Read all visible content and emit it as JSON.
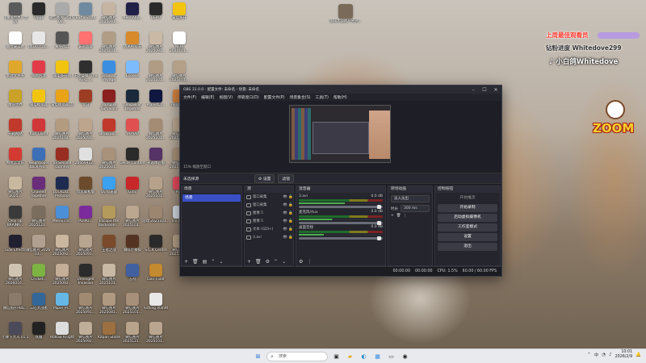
{
  "desktop": {
    "icons": [
      {
        "label": "《魔兽世界》大战",
        "color": "#5b5b5b"
      },
      {
        "label": "雅金豪工站",
        "color": "#ffffff"
      },
      {
        "label": "新建文件夹",
        "color": "#e0a82b"
      },
      {
        "label": "魔兽世界",
        "color": "#c9a227"
      },
      {
        "label": "开箱网站",
        "color": "#c0392b"
      },
      {
        "label": "网易云音乐",
        "color": "#d33a31"
      },
      {
        "label": "微信图片 2025...",
        "color": "#c9b8a0"
      },
      {
        "label": "Only Up BRAINR...",
        "color": "#3a3a3a"
      },
      {
        "label": "Side Effects",
        "color": "#202030"
      },
      {
        "label": "微信图片 2026010...",
        "color": "#cfc4b2"
      },
      {
        "label": "微信图片PBG...",
        "color": "#8b7b6a"
      },
      {
        "label": "小萝卜大人 v1.1",
        "color": "#4a4a5a"
      },
      {
        "label": "Oops",
        "color": "#2a2a2a"
      },
      {
        "label": "b6Dd1f1b...",
        "color": "#e7e7e7"
      },
      {
        "label": "网易回放",
        "color": "#e23b48"
      },
      {
        "label": "雷电模拟器",
        "color": "#f2c40f"
      },
      {
        "label": "Riot Client",
        "color": "#d13639"
      },
      {
        "label": "Neighbours back Fro...",
        "color": "#3d6fb6"
      },
      {
        "label": "Chained Together",
        "color": "#6a2d7a"
      },
      {
        "label": "微信图片 2025123...",
        "color": "#7a6d5d"
      },
      {
        "label": "微信图片 2026-01...",
        "color": "#b0a090"
      },
      {
        "label": "Cricket...",
        "color": "#7cb342"
      },
      {
        "label": "三吃大战者",
        "color": "#336699"
      },
      {
        "label": "铁狼",
        "color": "#222222"
      },
      {
        "label": "微信图片 2025-08...",
        "color": "#aaaaaa"
      },
      {
        "label": "撒豆战兵",
        "color": "#555555"
      },
      {
        "label": "雷电多开器",
        "color": "#f2c40f"
      },
      {
        "label": "雷电模拟器10",
        "color": "#e8a316"
      },
      {
        "label": "微信图片 2025102...",
        "color": "#b39b80"
      },
      {
        "label": "6x Second Dummy",
        "color": "#992d22"
      },
      {
        "label": "LOCKDO... Protocol",
        "color": "#1d2b50"
      },
      {
        "label": "MemoTra...",
        "color": "#4b8fd6"
      },
      {
        "label": "微信图片 2025092...",
        "color": "#cbb7a0"
      },
      {
        "label": "微信图片 2025092...",
        "color": "#c4ae98"
      },
      {
        "label": "Paper Pl...",
        "color": "#65b8e6"
      },
      {
        "label": "Hollow Knight",
        "color": "#dddddd"
      },
      {
        "label": "BattleState",
        "color": "#6f8aa0"
      },
      {
        "label": "霸道总裁",
        "color": "#ff7070"
      },
      {
        "label": "王之盛拜 (The King...)",
        "color": "#2f2f2f"
      },
      {
        "label": "令马",
        "color": "#9b3c23"
      },
      {
        "label": "微信图片 2025091...",
        "color": "#bda48c"
      },
      {
        "label": "2b6b9412...",
        "color": "#e0e0e0"
      },
      {
        "label": "饥荒联机版",
        "color": "#6b4b2b"
      },
      {
        "label": "POIPU...",
        "color": "#7b2b9b"
      },
      {
        "label": "微信图片 2025091...",
        "color": "#b8a58f"
      },
      {
        "label": "Unhinged Invasion",
        "color": "#2b2b2b"
      },
      {
        "label": "微信图片 2025091...",
        "color": "#a08a72"
      },
      {
        "label": "微信图片 2025092...",
        "color": "#bfae9a"
      },
      {
        "label": "微信图片 2025091...",
        "color": "#c5b4a1"
      },
      {
        "label": "微信图片 2025101...",
        "color": "#b19c85"
      },
      {
        "label": "Brainrot Voyage",
        "color": "#3b8ee0"
      },
      {
        "label": "Vampire Survivors",
        "color": "#8b2020"
      },
      {
        "label": "Breakabl...",
        "color": "#c0392b"
      },
      {
        "label": "微信图片 2025081...",
        "color": "#a9927a"
      },
      {
        "label": "UU加速器",
        "color": "#3aa0f0"
      },
      {
        "label": "Escape the Backroom...",
        "color": "#b59b5b"
      },
      {
        "label": "王者之战",
        "color": "#7a4a2a"
      },
      {
        "label": "微信图片 2025101...",
        "color": "#c8b9a4"
      },
      {
        "label": "微信图片 2025081...",
        "color": "#af9981"
      },
      {
        "label": "Kapan Stone",
        "color": "#9c7040"
      },
      {
        "label": "NeonAby...",
        "color": "#202048"
      },
      {
        "label": "逃离鸭科夫",
        "color": "#d88a2a"
      },
      {
        "label": "Ecoone",
        "color": "#7dbbff"
      },
      {
        "label": "League of Legends",
        "color": "#1a2a3a"
      },
      {
        "label": "YAPYAP",
        "color": "#e05050"
      },
      {
        "label": "Gelite Content",
        "color": "#2a2a2a"
      },
      {
        "label": "Gitic",
        "color": "#c8282a"
      },
      {
        "label": "微信图片 2025101...",
        "color": "#bba68f"
      },
      {
        "label": "咖啡厅模拟",
        "color": "#553322"
      },
      {
        "label": "方舟",
        "color": "#4060a0"
      },
      {
        "label": "微信图片 2025101...",
        "color": "#a79079"
      },
      {
        "label": "微信图片 2025121...",
        "color": "#b8a48d"
      },
      {
        "label": "REPO",
        "color": "#2a2a2a"
      },
      {
        "label": "微信图片 2025091...",
        "color": "#cab9a5"
      },
      {
        "label": "微信图片 2025101...",
        "color": "#b09b84"
      },
      {
        "label": "PlanetCr...",
        "color": "#101840"
      },
      {
        "label": "微信图片 2025101...",
        "color": "#a48c74"
      },
      {
        "label": "光遇体验服",
        "color": "#553366"
      },
      {
        "label": "微信图片 2025101...",
        "color": "#b6a28b"
      },
      {
        "label": "游戏 2025101...",
        "color": "#9c8670"
      },
      {
        "label": "S.C.K Centre",
        "color": "#2a2a2a"
      },
      {
        "label": "Lian's Bar",
        "color": "#c48a30"
      },
      {
        "label": "Fishing Planet",
        "color": "#e8e8e8"
      },
      {
        "label": "微信图片 2025101...",
        "color": "#baa690"
      },
      {
        "label": "雷电多开",
        "color": "#f2c40f"
      },
      {
        "label": "NEW 2025101...",
        "color": "#ffffff"
      },
      {
        "label": "微信图片 2025101...",
        "color": "#b49f88"
      },
      {
        "label": "Horizon...",
        "color": "#d08040"
      },
      {
        "label": "微信图片 2025101...",
        "color": "#bca791"
      },
      {
        "label": "微信图片 2025101...",
        "color": "#a99178"
      },
      {
        "label": "PDF",
        "color": "#e84a5f"
      },
      {
        "label": "Ice Lake",
        "color": "#d0d8e0"
      },
      {
        "label": "微信图片 2025101...",
        "color": "#b29d86"
      }
    ],
    "right_icon": {
      "label": "咖啡大战跑户突突...",
      "color": "#7a6a5a"
    }
  },
  "overlay": {
    "title_line": "上周最佳观看员",
    "fans_line": "钻粉进度 Whitedove299",
    "tiktok_line": "小白鸽Whitedove",
    "logo_text": "ZOOM",
    "accent_color": "#ff3b2f"
  },
  "obs": {
    "title": "OBS 31.0.0 - 配置文件: 未命名 - 场景: 未命名",
    "menu": [
      "文件(F)",
      "编辑(E)",
      "视图(V)",
      "停靠窗口(D)",
      "配置文件(P)",
      "场景集合(S)",
      "工具(T)",
      "帮助(H)"
    ],
    "zoom": "15%  缩放至窗口",
    "source_bar": {
      "name": "未选择源",
      "settings": "⚙ 设置",
      "filters": "滤镜"
    },
    "scenes": {
      "title": "场景",
      "items": [
        "场景"
      ]
    },
    "sources": {
      "title": "源",
      "items": [
        "窗口采集",
        "窗口采集",
        "图像 5",
        "图像 5",
        "文本 (GDI+)",
        "3.avi"
      ]
    },
    "mixer": {
      "title": "混音器",
      "channels": [
        {
          "name": "3.avi",
          "db": "0.0 dB",
          "level": "55%"
        },
        {
          "name": "麦克风/Aux",
          "db": "0.0 dB",
          "level": "40%"
        },
        {
          "name": "桌面音频",
          "db": "0.0 dB",
          "level": "30%"
        }
      ]
    },
    "transitions": {
      "title": "转场动画",
      "selected": "淡入淡出",
      "duration_label": "时长",
      "duration": "300 ms"
    },
    "controls": {
      "title": "控制按钮",
      "start_stream": "开始推流",
      "start_record": "开始录制",
      "virtual_cam": "启动虚拟摄像机",
      "studio_mode": "工作室模式",
      "settings": "设置",
      "exit": "退出"
    },
    "status": {
      "rec_time": "00:00:00",
      "stream_time": "00:00:00",
      "cpu": "CPU: 1.5%",
      "fps": "60.00 / 60.00 FPS"
    }
  },
  "taskbar": {
    "search_placeholder": "搜索",
    "time": "10:01",
    "date": "2026/2/9",
    "ime": "中",
    "apps": [
      "start-icon",
      "search",
      "task-view-icon",
      "file-explorer-icon",
      "edge-icon",
      "photos-icon",
      "terminal-icon",
      "obs-icon"
    ]
  }
}
